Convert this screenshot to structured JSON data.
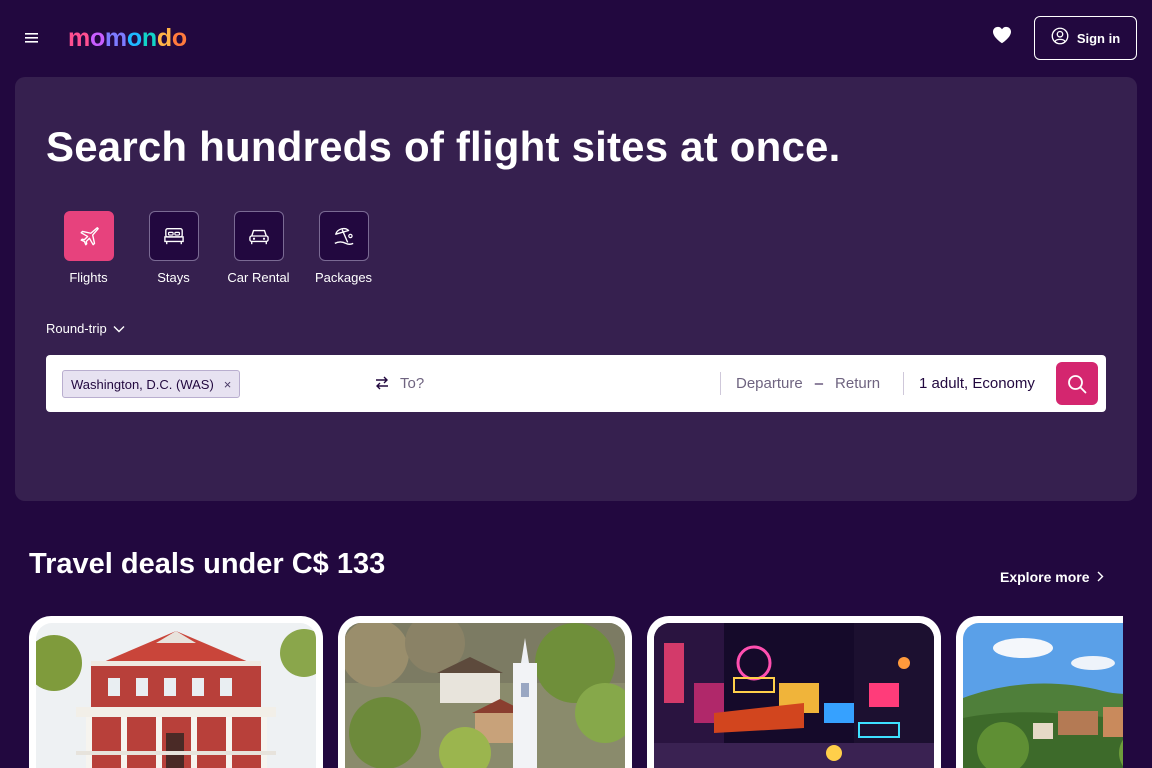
{
  "header": {
    "logo_text": "momondo",
    "signin_label": "Sign in",
    "icons": [
      "hamburger-menu-icon",
      "heart-icon",
      "user-circle-icon"
    ]
  },
  "hero": {
    "title": "Search hundreds of flight sites at once.",
    "modes": [
      {
        "label": "Flights",
        "icon": "plane-icon",
        "active": true
      },
      {
        "label": "Stays",
        "icon": "bed-icon",
        "active": false
      },
      {
        "label": "Car Rental",
        "icon": "car-icon",
        "active": false
      },
      {
        "label": "Packages",
        "icon": "beach-umbrella-icon",
        "active": false
      }
    ],
    "trip_type": "Round-trip"
  },
  "search": {
    "origin": "Washington, D.C. (WAS)",
    "origin_remove": "×",
    "destination_placeholder": "To?",
    "departure": "Departure",
    "date_separator": "–",
    "return": "Return",
    "travelers": "1 adult, Economy"
  },
  "deals": {
    "title": "Travel deals under C$ 133",
    "explore_label": "Explore more"
  },
  "colors": {
    "background": "#22083f",
    "panel": "#36204f",
    "accent": "#e7427d",
    "search_button": "#d4266f"
  }
}
